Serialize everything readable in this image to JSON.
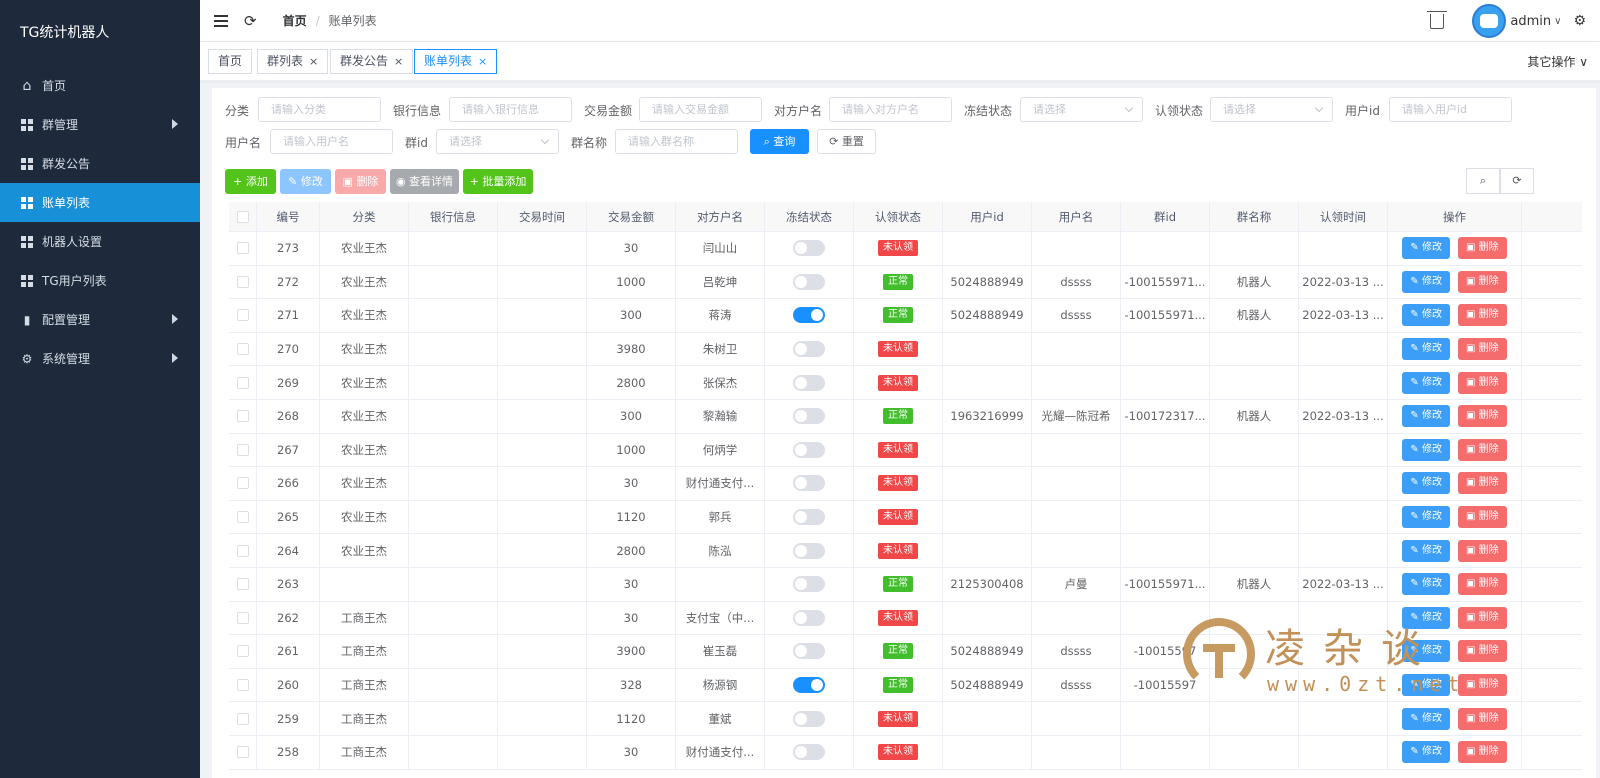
{
  "app": {
    "title": "TG统计机器人"
  },
  "sidebar": {
    "items": [
      {
        "label": "首页",
        "icon": "home-icon",
        "active": false,
        "expandable": false
      },
      {
        "label": "群管理",
        "icon": "grid-icon",
        "active": false,
        "expandable": true
      },
      {
        "label": "群发公告",
        "icon": "grid-icon",
        "active": false,
        "expandable": false
      },
      {
        "label": "账单列表",
        "icon": "grid-icon",
        "active": true,
        "expandable": false
      },
      {
        "label": "机器人设置",
        "icon": "grid-icon",
        "active": false,
        "expandable": false
      },
      {
        "label": "TG用户列表",
        "icon": "grid-icon",
        "active": false,
        "expandable": false
      },
      {
        "label": "配置管理",
        "icon": "bar-chart-icon",
        "active": false,
        "expandable": true
      },
      {
        "label": "系统管理",
        "icon": "gear-icon",
        "active": false,
        "expandable": true
      }
    ]
  },
  "header": {
    "breadcrumb": {
      "home": "首页",
      "current": "账单列表"
    },
    "user": "admin"
  },
  "tags": {
    "items": [
      {
        "label": "首页",
        "closable": false,
        "active": false
      },
      {
        "label": "群列表",
        "closable": true,
        "active": false
      },
      {
        "label": "群发公告",
        "closable": true,
        "active": false
      },
      {
        "label": "账单列表",
        "closable": true,
        "active": true
      }
    ],
    "close_glyph": "×",
    "other_ops": "其它操作"
  },
  "filters": {
    "category": {
      "label": "分类",
      "placeholder": "请输入分类"
    },
    "bank": {
      "label": "银行信息",
      "placeholder": "请输入银行信息"
    },
    "amount": {
      "label": "交易金额",
      "placeholder": "请输入交易金额"
    },
    "counterparty": {
      "label": "对方户名",
      "placeholder": "请输入对方户名"
    },
    "freeze": {
      "label": "冻结状态",
      "placeholder": "请选择"
    },
    "claim": {
      "label": "认领状态",
      "placeholder": "请选择"
    },
    "user_id": {
      "label": "用户id",
      "placeholder": "请输入用户id"
    },
    "username": {
      "label": "用户名",
      "placeholder": "请输入用户名"
    },
    "group_id": {
      "label": "群id",
      "placeholder": "请选择"
    },
    "group_name": {
      "label": "群名称",
      "placeholder": "请输入群名称"
    },
    "search_label": "查询",
    "reset_label": "重置"
  },
  "toolbar": {
    "add_label": "添加",
    "edit_label": "修改",
    "delete_label": "删除",
    "detail_label": "查看详情",
    "batch_add_label": "批量添加"
  },
  "table": {
    "columns": [
      "编号",
      "分类",
      "银行信息",
      "交易时间",
      "交易金额",
      "对方户名",
      "冻结状态",
      "认领状态",
      "用户id",
      "用户名",
      "群id",
      "群名称",
      "认领时间",
      "操作"
    ],
    "edit_label": "修改",
    "delete_label": "删除",
    "status_labels": {
      "unclaimed": "未认领",
      "normal": "正常"
    },
    "rows": [
      {
        "id": "273",
        "category": "农业王杰",
        "bank": "",
        "time": "",
        "amount": "30",
        "counterparty": "闫山山",
        "frozen": false,
        "claim": "unclaimed",
        "user_id": "",
        "username": "",
        "group_id": "",
        "group_name": "",
        "claim_time": ""
      },
      {
        "id": "272",
        "category": "农业王杰",
        "bank": "",
        "time": "",
        "amount": "1000",
        "counterparty": "吕乾坤",
        "frozen": false,
        "claim": "normal",
        "user_id": "5024888949",
        "username": "dssss",
        "group_id": "-100155971...",
        "group_name": "机器人",
        "claim_time": "2022-03-13 ..."
      },
      {
        "id": "271",
        "category": "农业王杰",
        "bank": "",
        "time": "",
        "amount": "300",
        "counterparty": "蒋涛",
        "frozen": true,
        "claim": "normal",
        "user_id": "5024888949",
        "username": "dssss",
        "group_id": "-100155971...",
        "group_name": "机器人",
        "claim_time": "2022-03-13 ..."
      },
      {
        "id": "270",
        "category": "农业王杰",
        "bank": "",
        "time": "",
        "amount": "3980",
        "counterparty": "朱树卫",
        "frozen": false,
        "claim": "unclaimed",
        "user_id": "",
        "username": "",
        "group_id": "",
        "group_name": "",
        "claim_time": ""
      },
      {
        "id": "269",
        "category": "农业王杰",
        "bank": "",
        "time": "",
        "amount": "2800",
        "counterparty": "张保杰",
        "frozen": false,
        "claim": "unclaimed",
        "user_id": "",
        "username": "",
        "group_id": "",
        "group_name": "",
        "claim_time": ""
      },
      {
        "id": "268",
        "category": "农业王杰",
        "bank": "",
        "time": "",
        "amount": "300",
        "counterparty": "黎瀚输",
        "frozen": false,
        "claim": "normal",
        "user_id": "1963216999",
        "username": "光耀—陈冠希",
        "group_id": "-100172317...",
        "group_name": "机器人",
        "claim_time": "2022-03-13 ..."
      },
      {
        "id": "267",
        "category": "农业王杰",
        "bank": "",
        "time": "",
        "amount": "1000",
        "counterparty": "何炳学",
        "frozen": false,
        "claim": "unclaimed",
        "user_id": "",
        "username": "",
        "group_id": "",
        "group_name": "",
        "claim_time": ""
      },
      {
        "id": "266",
        "category": "农业王杰",
        "bank": "",
        "time": "",
        "amount": "30",
        "counterparty": "财付通支付...",
        "frozen": false,
        "claim": "unclaimed",
        "user_id": "",
        "username": "",
        "group_id": "",
        "group_name": "",
        "claim_time": ""
      },
      {
        "id": "265",
        "category": "农业王杰",
        "bank": "",
        "time": "",
        "amount": "1120",
        "counterparty": "郭兵",
        "frozen": false,
        "claim": "unclaimed",
        "user_id": "",
        "username": "",
        "group_id": "",
        "group_name": "",
        "claim_time": ""
      },
      {
        "id": "264",
        "category": "农业王杰",
        "bank": "",
        "time": "",
        "amount": "2800",
        "counterparty": "陈泓",
        "frozen": false,
        "claim": "unclaimed",
        "user_id": "",
        "username": "",
        "group_id": "",
        "group_name": "",
        "claim_time": ""
      },
      {
        "id": "263",
        "category": "",
        "bank": "",
        "time": "",
        "amount": "30",
        "counterparty": "",
        "frozen": false,
        "claim": "normal",
        "user_id": "2125300408",
        "username": "卢曼",
        "group_id": "-100155971...",
        "group_name": "机器人",
        "claim_time": "2022-03-13 ..."
      },
      {
        "id": "262",
        "category": "工商王杰",
        "bank": "",
        "time": "",
        "amount": "30",
        "counterparty": "支付宝（中...",
        "frozen": false,
        "claim": "unclaimed",
        "user_id": "",
        "username": "",
        "group_id": "",
        "group_name": "",
        "claim_time": ""
      },
      {
        "id": "261",
        "category": "工商王杰",
        "bank": "",
        "time": "",
        "amount": "3900",
        "counterparty": "崔玉磊",
        "frozen": false,
        "claim": "normal",
        "user_id": "5024888949",
        "username": "dssss",
        "group_id": "-10015597",
        "group_name": "",
        "claim_time": ""
      },
      {
        "id": "260",
        "category": "工商王杰",
        "bank": "",
        "time": "",
        "amount": "328",
        "counterparty": "杨源钢",
        "frozen": true,
        "claim": "normal",
        "user_id": "5024888949",
        "username": "dssss",
        "group_id": "-10015597",
        "group_name": "",
        "claim_time": ""
      },
      {
        "id": "259",
        "category": "工商王杰",
        "bank": "",
        "time": "",
        "amount": "1120",
        "counterparty": "董斌",
        "frozen": false,
        "claim": "unclaimed",
        "user_id": "",
        "username": "",
        "group_id": "",
        "group_name": "",
        "claim_time": ""
      },
      {
        "id": "258",
        "category": "工商王杰",
        "bank": "",
        "time": "",
        "amount": "30",
        "counterparty": "财付通支付...",
        "frozen": false,
        "claim": "unclaimed",
        "user_id": "",
        "username": "",
        "group_id": "",
        "group_name": "",
        "claim_time": ""
      }
    ]
  },
  "watermark": {
    "title": "凌杂谈",
    "url": "www.0zt.net"
  },
  "colors": {
    "sidebar_bg": "#1e2a3c",
    "accent": "#1890ff",
    "success": "#42bd2c",
    "danger": "#f04848"
  }
}
